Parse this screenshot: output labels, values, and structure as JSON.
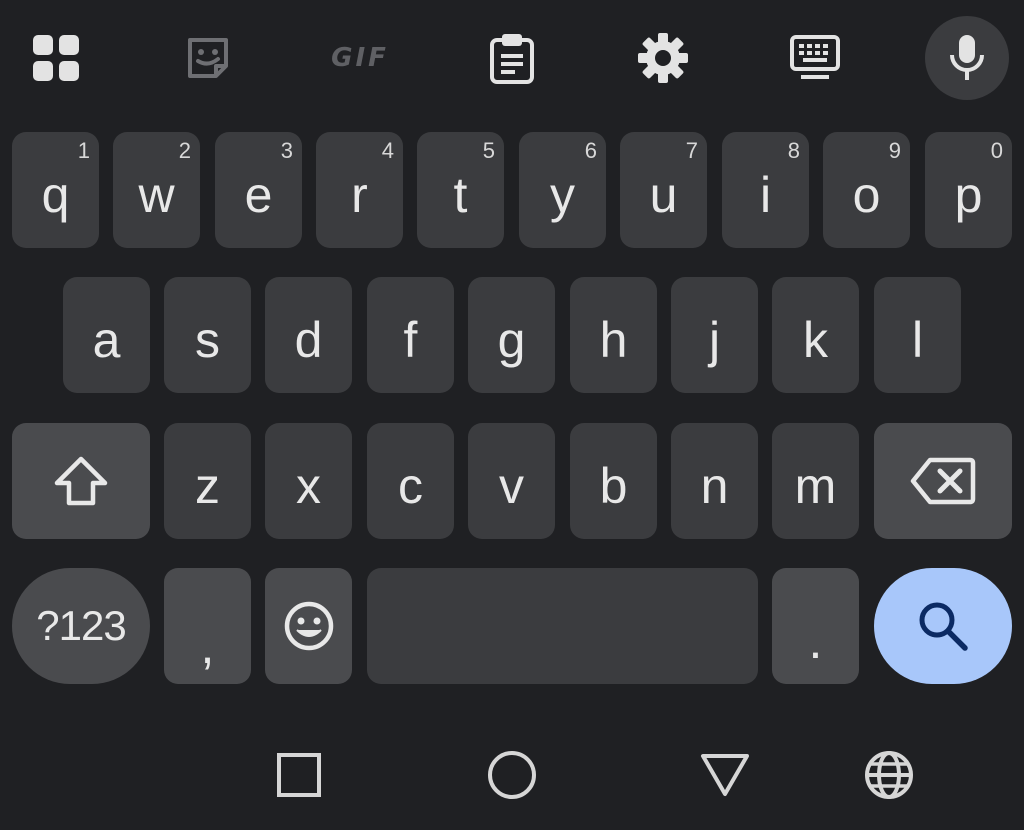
{
  "toolbar": {
    "gif_label": "GIF"
  },
  "keys": {
    "row1": [
      {
        "label": "q",
        "hint": "1"
      },
      {
        "label": "w",
        "hint": "2"
      },
      {
        "label": "e",
        "hint": "3"
      },
      {
        "label": "r",
        "hint": "4"
      },
      {
        "label": "t",
        "hint": "5"
      },
      {
        "label": "y",
        "hint": "6"
      },
      {
        "label": "u",
        "hint": "7"
      },
      {
        "label": "i",
        "hint": "8"
      },
      {
        "label": "o",
        "hint": "9"
      },
      {
        "label": "p",
        "hint": "0"
      }
    ],
    "row2": [
      "a",
      "s",
      "d",
      "f",
      "g",
      "h",
      "j",
      "k",
      "l"
    ],
    "row3": [
      "z",
      "x",
      "c",
      "v",
      "b",
      "n",
      "m"
    ],
    "bottom": {
      "symbols_label": "?123",
      "comma_label": ",",
      "period_label": "."
    }
  },
  "colors": {
    "background": "#1f2023",
    "key": "#3b3c3f",
    "special_key": "#4a4b4e",
    "search_key": "#a8c7fa",
    "search_icon": "#0b2a63"
  },
  "icons": {
    "toolbar": [
      "apps-grid-icon",
      "sticker-icon",
      "gif-icon",
      "clipboard-icon",
      "gear-icon",
      "keyboard-icon",
      "microphone-icon"
    ],
    "nav": [
      "recents-square-icon",
      "home-circle-icon",
      "back-triangle-icon",
      "globe-icon"
    ]
  }
}
